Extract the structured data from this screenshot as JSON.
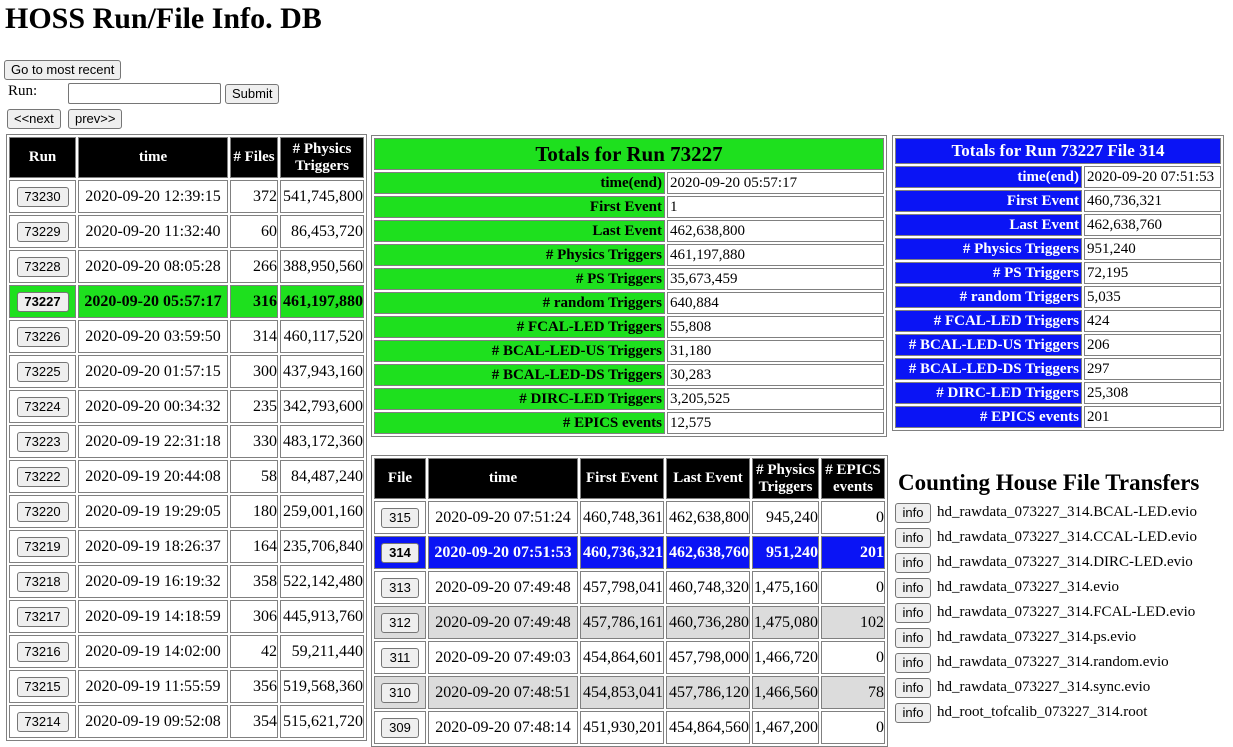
{
  "page": {
    "title": "HOSS Run/File Info. DB"
  },
  "nav": {
    "most_recent_label": "Go to most recent",
    "run_label": "Run:",
    "run_value": "",
    "submit_label": "Submit",
    "next_label": "<<next",
    "prev_label": "prev>>"
  },
  "runs": {
    "headers": [
      "Run",
      "time",
      "# Files",
      "# Physics Triggers"
    ],
    "rows": [
      {
        "run": "73230",
        "time": "2020-09-20 12:39:15",
        "files": "372",
        "triggers": "541,745,800"
      },
      {
        "run": "73229",
        "time": "2020-09-20 11:32:40",
        "files": "60",
        "triggers": "86,453,720"
      },
      {
        "run": "73228",
        "time": "2020-09-20 08:05:28",
        "files": "266",
        "triggers": "388,950,560"
      },
      {
        "run": "73227",
        "time": "2020-09-20 05:57:17",
        "files": "316",
        "triggers": "461,197,880"
      },
      {
        "run": "73226",
        "time": "2020-09-20 03:59:50",
        "files": "314",
        "triggers": "460,117,520"
      },
      {
        "run": "73225",
        "time": "2020-09-20 01:57:15",
        "files": "300",
        "triggers": "437,943,160"
      },
      {
        "run": "73224",
        "time": "2020-09-20 00:34:32",
        "files": "235",
        "triggers": "342,793,600"
      },
      {
        "run": "73223",
        "time": "2020-09-19 22:31:18",
        "files": "330",
        "triggers": "483,172,360"
      },
      {
        "run": "73222",
        "time": "2020-09-19 20:44:08",
        "files": "58",
        "triggers": "84,487,240"
      },
      {
        "run": "73220",
        "time": "2020-09-19 19:29:05",
        "files": "180",
        "triggers": "259,001,160"
      },
      {
        "run": "73219",
        "time": "2020-09-19 18:26:37",
        "files": "164",
        "triggers": "235,706,840"
      },
      {
        "run": "73218",
        "time": "2020-09-19 16:19:32",
        "files": "358",
        "triggers": "522,142,480"
      },
      {
        "run": "73217",
        "time": "2020-09-19 14:18:59",
        "files": "306",
        "triggers": "445,913,760"
      },
      {
        "run": "73216",
        "time": "2020-09-19 14:02:00",
        "files": "42",
        "triggers": "59,211,440"
      },
      {
        "run": "73215",
        "time": "2020-09-19 11:55:59",
        "files": "356",
        "triggers": "519,568,360"
      },
      {
        "run": "73214",
        "time": "2020-09-19 09:52:08",
        "files": "354",
        "triggers": "515,621,720"
      }
    ]
  },
  "run_totals": {
    "title": "Totals for Run 73227",
    "rows": [
      {
        "label": "time(end)",
        "value": "2020-09-20 05:57:17"
      },
      {
        "label": "First Event",
        "value": "1"
      },
      {
        "label": "Last Event",
        "value": "462,638,800"
      },
      {
        "label": "# Physics Triggers",
        "value": "461,197,880"
      },
      {
        "label": "# PS Triggers",
        "value": "35,673,459"
      },
      {
        "label": "# random Triggers",
        "value": "640,884"
      },
      {
        "label": "# FCAL-LED Triggers",
        "value": "55,808"
      },
      {
        "label": "# BCAL-LED-US Triggers",
        "value": "31,180"
      },
      {
        "label": "# BCAL-LED-DS Triggers",
        "value": "30,283"
      },
      {
        "label": "# DIRC-LED Triggers",
        "value": "3,205,525"
      },
      {
        "label": "# EPICS events",
        "value": "12,575"
      }
    ]
  },
  "file_totals": {
    "title": "Totals for Run 73227 File 314",
    "rows": [
      {
        "label": "time(end)",
        "value": "2020-09-20 07:51:53"
      },
      {
        "label": "First Event",
        "value": "460,736,321"
      },
      {
        "label": "Last Event",
        "value": "462,638,760"
      },
      {
        "label": "# Physics Triggers",
        "value": "951,240"
      },
      {
        "label": "# PS Triggers",
        "value": "72,195"
      },
      {
        "label": "# random Triggers",
        "value": "5,035"
      },
      {
        "label": "# FCAL-LED Triggers",
        "value": "424"
      },
      {
        "label": "# BCAL-LED-US Triggers",
        "value": "206"
      },
      {
        "label": "# BCAL-LED-DS Triggers",
        "value": "297"
      },
      {
        "label": "# DIRC-LED Triggers",
        "value": "25,308"
      },
      {
        "label": "# EPICS events",
        "value": "201"
      }
    ]
  },
  "files": {
    "headers": [
      "File",
      "time",
      "First Event",
      "Last Event",
      "# Physics Triggers",
      "# EPICS events"
    ],
    "rows": [
      {
        "file": "315",
        "time": "2020-09-20 07:51:24",
        "first": "460,748,361",
        "last": "462,638,800",
        "triggers": "945,240",
        "epics": "0"
      },
      {
        "file": "314",
        "time": "2020-09-20 07:51:53",
        "first": "460,736,321",
        "last": "462,638,760",
        "triggers": "951,240",
        "epics": "201"
      },
      {
        "file": "313",
        "time": "2020-09-20 07:49:48",
        "first": "457,798,041",
        "last": "460,748,320",
        "triggers": "1,475,160",
        "epics": "0"
      },
      {
        "file": "312",
        "time": "2020-09-20 07:49:48",
        "first": "457,786,161",
        "last": "460,736,280",
        "triggers": "1,475,080",
        "epics": "102"
      },
      {
        "file": "311",
        "time": "2020-09-20 07:49:03",
        "first": "454,864,601",
        "last": "457,798,000",
        "triggers": "1,466,720",
        "epics": "0"
      },
      {
        "file": "310",
        "time": "2020-09-20 07:48:51",
        "first": "454,853,041",
        "last": "457,786,120",
        "triggers": "1,466,560",
        "epics": "78"
      },
      {
        "file": "309",
        "time": "2020-09-20 07:48:14",
        "first": "451,930,201",
        "last": "454,864,560",
        "triggers": "1,467,200",
        "epics": "0"
      }
    ]
  },
  "transfers": {
    "title": "Counting House File Transfers",
    "button_label": "info",
    "files": [
      "hd_rawdata_073227_314.BCAL-LED.evio",
      "hd_rawdata_073227_314.CCAL-LED.evio",
      "hd_rawdata_073227_314.DIRC-LED.evio",
      "hd_rawdata_073227_314.evio",
      "hd_rawdata_073227_314.FCAL-LED.evio",
      "hd_rawdata_073227_314.ps.evio",
      "hd_rawdata_073227_314.random.evio",
      "hd_rawdata_073227_314.sync.evio",
      "hd_root_tofcalib_073227_314.root"
    ]
  },
  "colors": {
    "selected_run": "#1ee01e",
    "selected_file": "#0a14f5",
    "header_bg": "#000000",
    "alt_row": "#dcdcdc"
  }
}
